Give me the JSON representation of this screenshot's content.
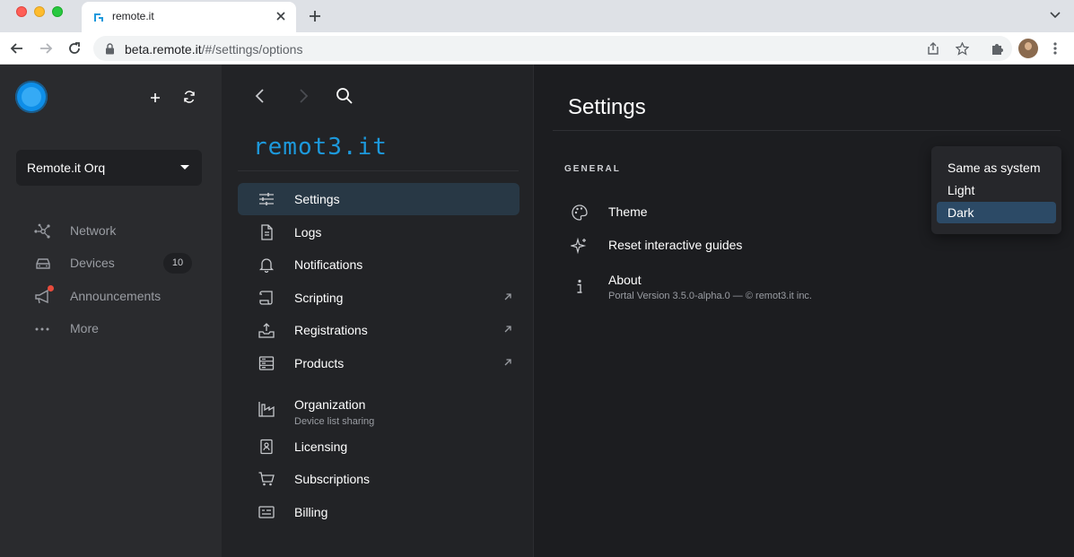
{
  "browser": {
    "tab_title": "remote.it",
    "url_host": "beta.remote.it",
    "url_path": "/#/settings/options"
  },
  "sidebar": {
    "org_name": "Remote.it Orq",
    "items": [
      {
        "label": "Network",
        "icon": "network-icon"
      },
      {
        "label": "Devices",
        "icon": "devices-icon",
        "badge": "10"
      },
      {
        "label": "Announcements",
        "icon": "megaphone-icon"
      },
      {
        "label": "More",
        "icon": "more-icon"
      }
    ]
  },
  "menu": {
    "brand": "remot3.it",
    "items": [
      {
        "label": "Settings",
        "icon": "sliders-icon",
        "active": true
      },
      {
        "label": "Logs",
        "icon": "document-icon"
      },
      {
        "label": "Notifications",
        "icon": "bell-icon"
      },
      {
        "label": "Scripting",
        "icon": "scroll-icon",
        "external": true
      },
      {
        "label": "Registrations",
        "icon": "upload-tray-icon",
        "external": true
      },
      {
        "label": "Products",
        "icon": "server-icon",
        "external": true
      },
      {
        "label": "Organization",
        "sub": "Device list sharing",
        "icon": "industry-icon"
      },
      {
        "label": "Licensing",
        "icon": "id-badge-icon"
      },
      {
        "label": "Subscriptions",
        "icon": "cart-icon"
      },
      {
        "label": "Billing",
        "icon": "billing-icon"
      }
    ]
  },
  "main": {
    "title": "Settings",
    "section": "GENERAL",
    "rows": [
      {
        "label": "Theme",
        "icon": "palette-icon"
      },
      {
        "label": "Reset interactive guides",
        "icon": "sparkles-icon"
      },
      {
        "label": "About",
        "sub": "Portal Version 3.5.0-alpha.0 — © remot3.it inc.",
        "icon": "info-icon"
      }
    ]
  },
  "theme_menu": {
    "options": [
      "Same as system",
      "Light",
      "Dark"
    ],
    "selected": "Dark"
  },
  "colors": {
    "accent": "#1d99dc",
    "selected_bg": "#2c4a66",
    "active_menu_bg": "#283845"
  }
}
